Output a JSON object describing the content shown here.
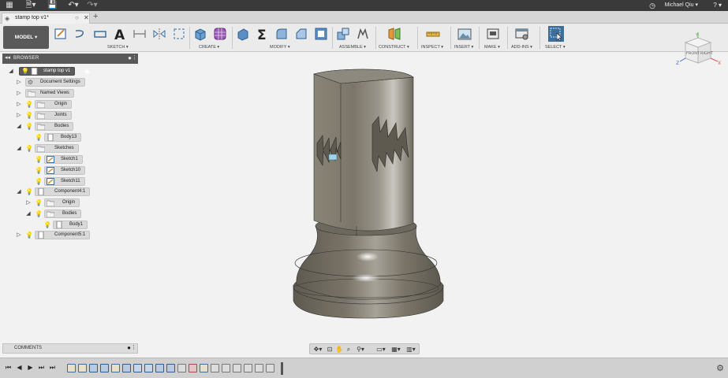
{
  "titlebar": {
    "user_name": "Michael Qiu ▾",
    "help": "? ▾",
    "icons": [
      "app-grid-icon",
      "file-menu-icon",
      "save-icon",
      "undo-icon",
      "redo-icon",
      "clock-icon"
    ]
  },
  "tabs": [
    {
      "label": "stamp top v1*",
      "active": true
    }
  ],
  "toolbar": {
    "workspace": "MODEL ▾",
    "groups": [
      {
        "label": "SKETCH ▾"
      },
      {
        "label": "CREATE ▾"
      },
      {
        "label": "MODIFY ▾"
      },
      {
        "label": "ASSEMBLE ▾"
      },
      {
        "label": "CONSTRUCT ▾"
      },
      {
        "label": "INSPECT ▾"
      },
      {
        "label": "INSERT ▾"
      },
      {
        "label": "MAKE ▾"
      },
      {
        "label": "ADD-INS ▾"
      },
      {
        "label": "SELECT ▾"
      }
    ]
  },
  "viewcube": {
    "faces": [
      "FRONT",
      "RIGHT"
    ],
    "axes": [
      "X",
      "Y",
      "Z"
    ]
  },
  "browser": {
    "title": "BROWSER",
    "items": [
      {
        "label": "stamp top v1"
      },
      {
        "label": "Document Settings"
      },
      {
        "label": "Named Views"
      },
      {
        "label": "Origin"
      },
      {
        "label": "Joints"
      },
      {
        "label": "Bodies"
      },
      {
        "label": "Body13"
      },
      {
        "label": "Sketches"
      },
      {
        "label": "Sketch1"
      },
      {
        "label": "Sketch10"
      },
      {
        "label": "Sketch11"
      },
      {
        "label": "Component4:1"
      },
      {
        "label": "Origin"
      },
      {
        "label": "Bodies"
      },
      {
        "label": "Body1"
      },
      {
        "label": "Component5:1"
      }
    ]
  },
  "comments": {
    "title": "COMMENTS"
  },
  "colors": {
    "titlebar": "#3a3a3a",
    "browser_header": "#595959",
    "select_accent": "#3d6f9b",
    "model_body": "#7d776b"
  }
}
